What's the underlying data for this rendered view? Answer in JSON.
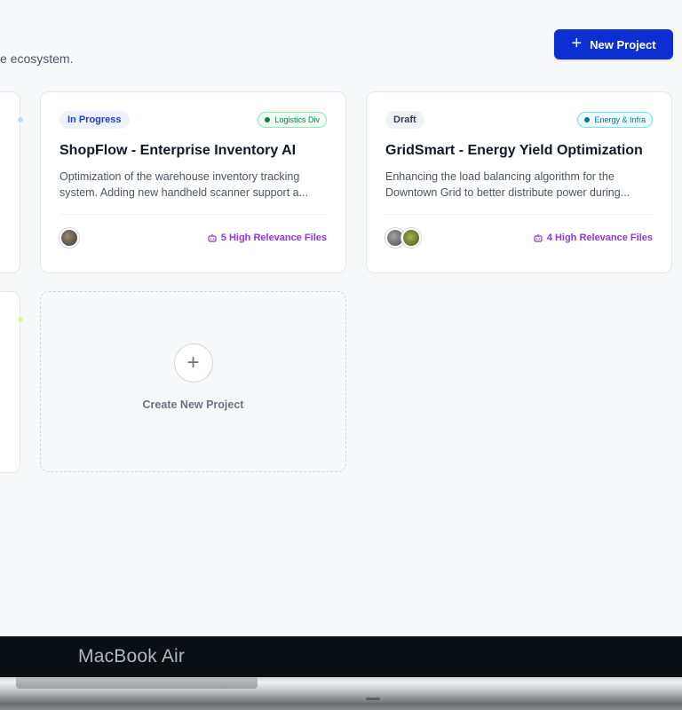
{
  "header": {
    "subtitle": "e ecosystem.",
    "new_project_label": "New Project",
    "new_project_icon": "plus-icon"
  },
  "projects": [
    {
      "status": "In Progress",
      "department": "Logistics Div",
      "title": "ShopFlow - Enterprise Inventory AI",
      "description_line1": "Optimization of the warehouse inventory tracking",
      "description_line2": "system. Adding new handheld scanner support a...",
      "avatars": [
        "avatar-photo"
      ],
      "files": "5 High Relevance Files"
    },
    {
      "status": "Draft",
      "department": "Energy & Infra",
      "title": "GridSmart - Energy Yield Optimization",
      "description_line1": "Enhancing the load balancing algorithm for the",
      "description_line2": "Downtown Grid to better distribute power during...",
      "avatars": [
        "avatar-photo",
        "avatar-photo"
      ],
      "files": "4 High Relevance Files"
    }
  ],
  "create_card": {
    "label": "Create New Project",
    "icon": "plus-icon"
  },
  "device": {
    "bezel_label": "MacBook Air"
  },
  "colors": {
    "primary": "#0b2fd0",
    "files_accent": "#9333ea",
    "logistics_tag": "#15803d",
    "energy_tag": "#0e7490",
    "background": "#f7f8fa"
  }
}
